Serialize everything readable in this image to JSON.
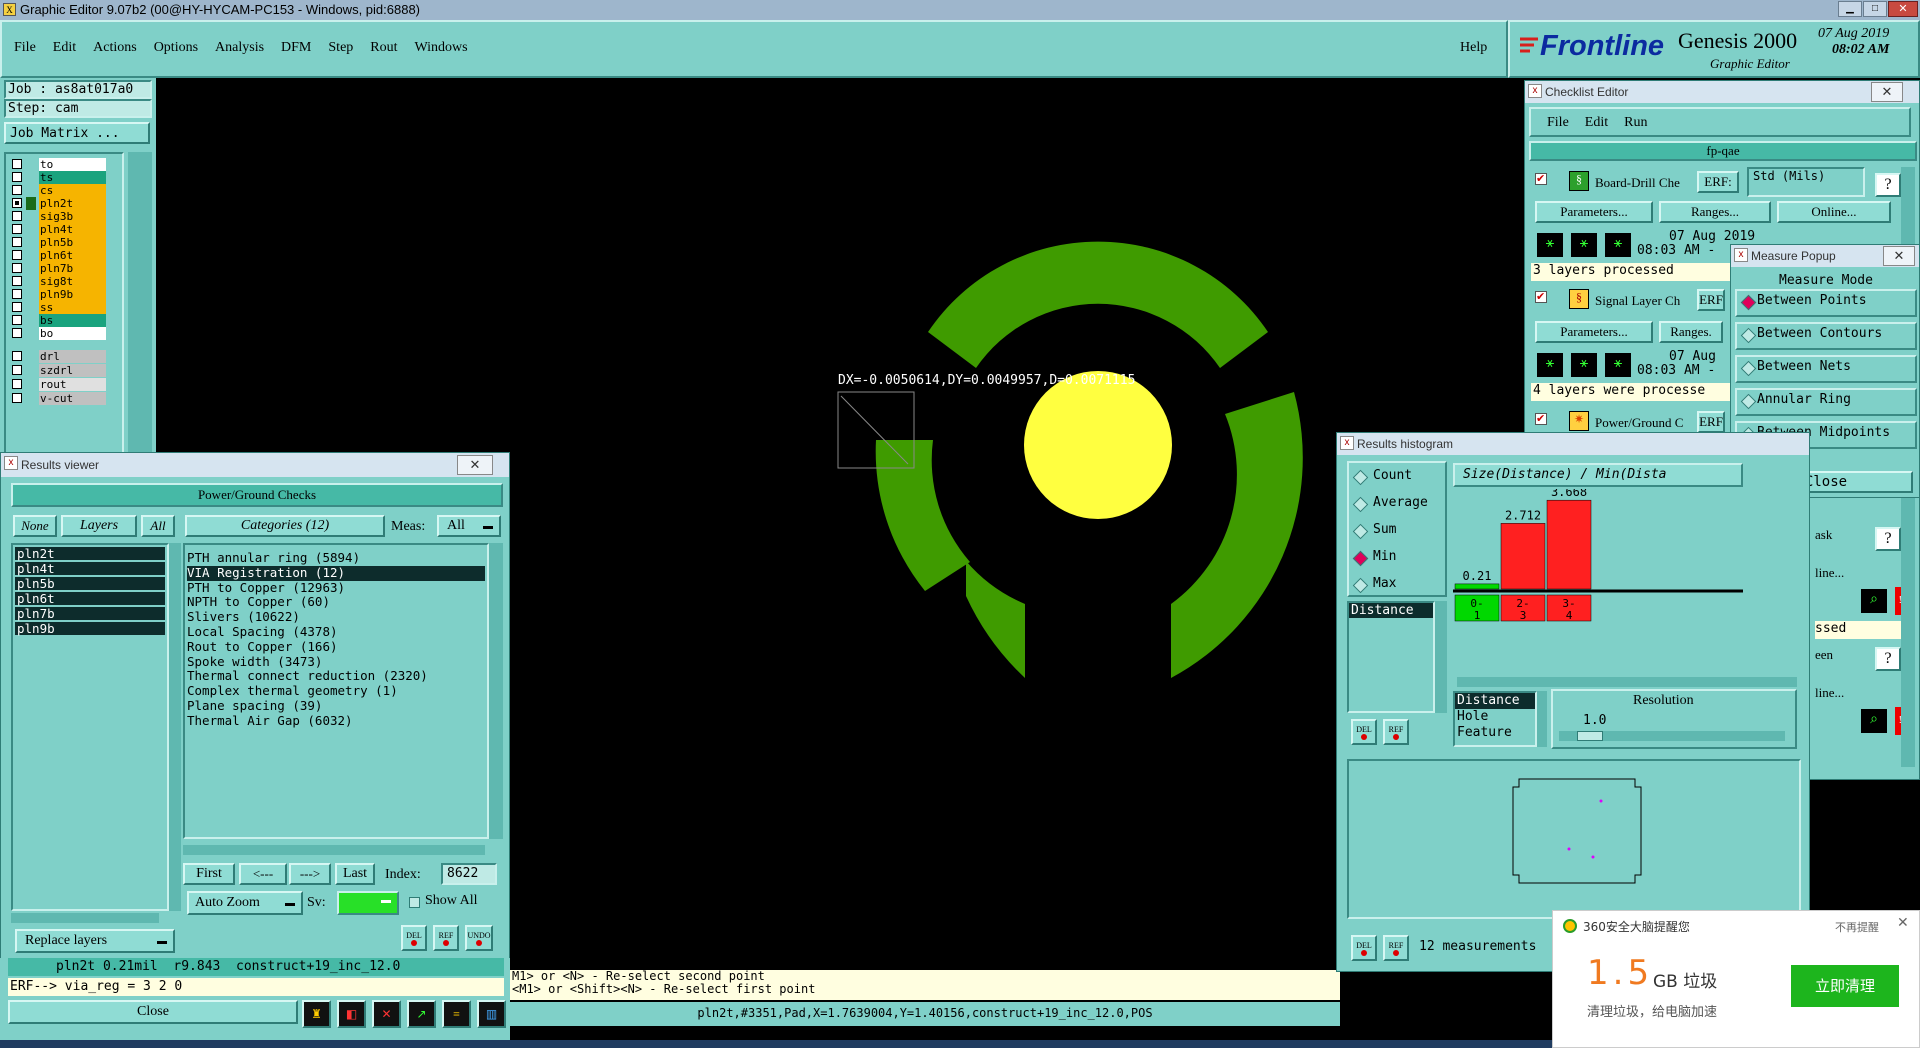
{
  "window": {
    "title": "Graphic Editor 9.07b2 (00@HY-HYCAM-PC153 - Windows, pid:6888)"
  },
  "menu": {
    "items": [
      "File",
      "Edit",
      "Actions",
      "Options",
      "Analysis",
      "DFM",
      "Step",
      "Rout",
      "Windows"
    ],
    "help": "Help"
  },
  "brand": {
    "logo": "Frontline",
    "product": "Genesis 2000",
    "subtitle": "Graphic Editor",
    "date": "07 Aug 2019",
    "time": "08:02 AM"
  },
  "left": {
    "job": "Job : as8at017a0",
    "step": "Step: cam",
    "job_matrix": "Job Matrix ...",
    "layers": [
      {
        "name": "to",
        "color": "#ffffff",
        "checked": false
      },
      {
        "name": "ts",
        "color": "#1aa37e",
        "checked": false
      },
      {
        "name": "cs",
        "color": "#f6b400",
        "checked": false
      },
      {
        "name": "pln2t",
        "color": "#f6b400",
        "checked": true
      },
      {
        "name": "sig3b",
        "color": "#f6b400",
        "checked": false
      },
      {
        "name": "pln4t",
        "color": "#f6b400",
        "checked": false
      },
      {
        "name": "pln5b",
        "color": "#f6b400",
        "checked": false
      },
      {
        "name": "pln6t",
        "color": "#f6b400",
        "checked": false
      },
      {
        "name": "pln7b",
        "color": "#f6b400",
        "checked": false
      },
      {
        "name": "sig8t",
        "color": "#f6b400",
        "checked": false
      },
      {
        "name": "pln9b",
        "color": "#f6b400",
        "checked": false
      },
      {
        "name": "ss",
        "color": "#f6b400",
        "checked": false
      },
      {
        "name": "bs",
        "color": "#1aa37e",
        "checked": false
      },
      {
        "name": "bo",
        "color": "#ffffff",
        "checked": false
      }
    ],
    "drill_layers": [
      {
        "name": "drl",
        "color": "#c0c0c0"
      },
      {
        "name": "szdrl",
        "color": "#c0c0c0"
      },
      {
        "name": "rout",
        "color": "#e0e0e0"
      },
      {
        "name": "v-cut",
        "color": "#c0c0c0"
      }
    ]
  },
  "canvas": {
    "measure_text": "DX=-0.0050614,DY=0.0049957,D=0.0071115"
  },
  "results_viewer": {
    "title": "Results viewer",
    "header": "Power/Ground Checks",
    "btn_none": "None",
    "btn_layers": "Layers",
    "btn_all": "All",
    "categories_label": "Categories (12)",
    "meas_label": "Meas:",
    "meas_value": "All",
    "layers": [
      "pln2t",
      "pln4t",
      "pln5b",
      "pln6t",
      "pln7b",
      "pln9b"
    ],
    "categories": [
      "PTH annular ring (5894)",
      "VIA Registration (12)",
      "PTH to Copper (12963)",
      "NPTH to Copper (60)",
      "Slivers (10622)",
      "Local Spacing (4378)",
      "Rout to Copper (166)",
      "Spoke width (3473)",
      "Thermal connect reduction (2320)",
      "Complex thermal geometry (1)",
      "Plane spacing (39)",
      "Thermal Air Gap (6032)"
    ],
    "nav": {
      "first": "First",
      "prev": "<---",
      "next": "--->",
      "last": "Last",
      "index_label": "Index:",
      "index_value": "8622"
    },
    "auto_zoom": "Auto Zoom",
    "sv_label": "Sv:",
    "show_all": "Show All",
    "replace_layers": "Replace layers",
    "small_btns": [
      "DEL",
      "REF",
      "UNDO"
    ]
  },
  "status": {
    "line1": "pln2t 0.21mil  r9.843  construct+19_inc_12.0",
    "erf": "ERF--> via_reg = 3 2 0",
    "close": "Close",
    "prompt1": "M1> or <N> - Re-select second point",
    "prompt2": "<M1> or <Shift><N> - Re-select first point",
    "coords": "pln2t,#3351,Pad,X=1.7639004,Y=1.40156,construct+19_inc_12.0,POS"
  },
  "checklist": {
    "title": "Checklist Editor",
    "menu": [
      "File",
      "Edit",
      "Run"
    ],
    "name": "fp-qae",
    "items": [
      {
        "label": "Board-Drill Che",
        "erf": "ERF:",
        "std": "Std (Mils)",
        "params": "Parameters...",
        "ranges": "Ranges...",
        "online": "Online...",
        "date": "07 Aug 2019",
        "time": "08:03 AM -",
        "status": "3 layers processed"
      },
      {
        "label": "Signal Layer Ch",
        "erf": "ERF",
        "params": "Parameters...",
        "ranges": "Ranges.",
        "date": "07 Aug",
        "time": "08:03 AM -",
        "status": "4 layers were processe"
      },
      {
        "label": "Power/Ground C",
        "erf": "ERF"
      }
    ],
    "frag": [
      "ask",
      "line...",
      "ssed",
      "een",
      "line..."
    ]
  },
  "measure_popup": {
    "title": "Measure Popup",
    "mode_label": "Measure Mode",
    "modes": [
      "Between Points",
      "Between Contours",
      "Between Nets",
      "Annular Ring",
      "Between Midpoints"
    ],
    "selected": 0,
    "close": "Close"
  },
  "histogram": {
    "title": "Results histogram",
    "stats": [
      "Count",
      "Average",
      "Sum",
      "Min",
      "Max"
    ],
    "selected_stat": 3,
    "header": "Size(Distance) / Min(Dista",
    "field_list": [
      "Distance"
    ],
    "fields2": [
      "Distance",
      "Hole",
      "Feature"
    ],
    "resolution_label": "Resolution",
    "resolution_value": "1.0",
    "measurements": "12 measurements",
    "small_btns": [
      "DEL",
      "REF"
    ]
  },
  "chart_data": {
    "type": "bar",
    "categories": [
      "0-1",
      "2-3",
      "3-4"
    ],
    "values": [
      0.21,
      2.712,
      3.668
    ],
    "colors": [
      "#00d800",
      "#ff2020",
      "#ff2020"
    ],
    "ylim": [
      0,
      3.8
    ]
  },
  "notification": {
    "app": "360安全大脑提醒您",
    "dismiss": "不再提醒",
    "amount": "1.5",
    "unit": "GB 垃圾",
    "desc": "清理垃圾，给电脑加速",
    "action": "立即清理"
  }
}
